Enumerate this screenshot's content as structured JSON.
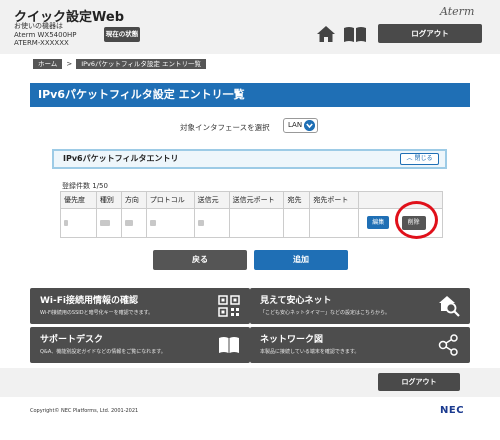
{
  "header": {
    "title": "クイック設定Web",
    "device_line1": "お使いの機器は",
    "device_line2": "Aterm WX5400HP",
    "device_line3": "ATERM-XXXXXX",
    "status_button": "現在の状態",
    "brand": "Aterm",
    "logout": "ログアウト"
  },
  "breadcrumb": {
    "home": "ホーム",
    "separator": ">",
    "current": "IPv6パケットフィルタ設定 エントリ一覧"
  },
  "page_title": "IPv6パケットフィルタ設定 エントリ一覧",
  "interface": {
    "label": "対象インタフェースを選択",
    "value": "LAN"
  },
  "entry_panel": {
    "title": "IPv6パケットフィルタエントリ",
    "collapse": "閉じる"
  },
  "count": "登録件数 1/50",
  "table": {
    "headers": [
      "優先度",
      "種別",
      "方向",
      "プロトコル",
      "送信元",
      "送信元ポート",
      "宛先",
      "宛先ポート",
      ""
    ],
    "edit_label": "編集",
    "delete_label": "削除"
  },
  "actions": {
    "back": "戻る",
    "add": "追加"
  },
  "tiles": [
    {
      "title": "Wi-Fi接続用情報の確認",
      "desc": "Wi-Fi接続用のSSIDと暗号化キーを確認できます。",
      "icon": "qr-code-icon"
    },
    {
      "title": "見えて安心ネット",
      "desc": "「こども安心ネットタイマー」などの設定はこちらから。",
      "icon": "magnifier-house-icon"
    },
    {
      "title": "サポートデスク",
      "desc": "Q&A、機能別設定ガイドなどの情報をご覧になれます。",
      "icon": "open-book-icon"
    },
    {
      "title": "ネットワーク図",
      "desc": "本製品に接続している端末を確認できます。",
      "icon": "network-nodes-icon"
    }
  ],
  "footer": {
    "logout": "ログアウト",
    "copyright": "Copyright© NEC Platforms, Ltd. 2001-2021",
    "logo": "NEC"
  },
  "colors": {
    "accent_blue": "#1f6fb5",
    "dark_button": "#4a4a4a",
    "highlight_red": "#e0101a"
  }
}
